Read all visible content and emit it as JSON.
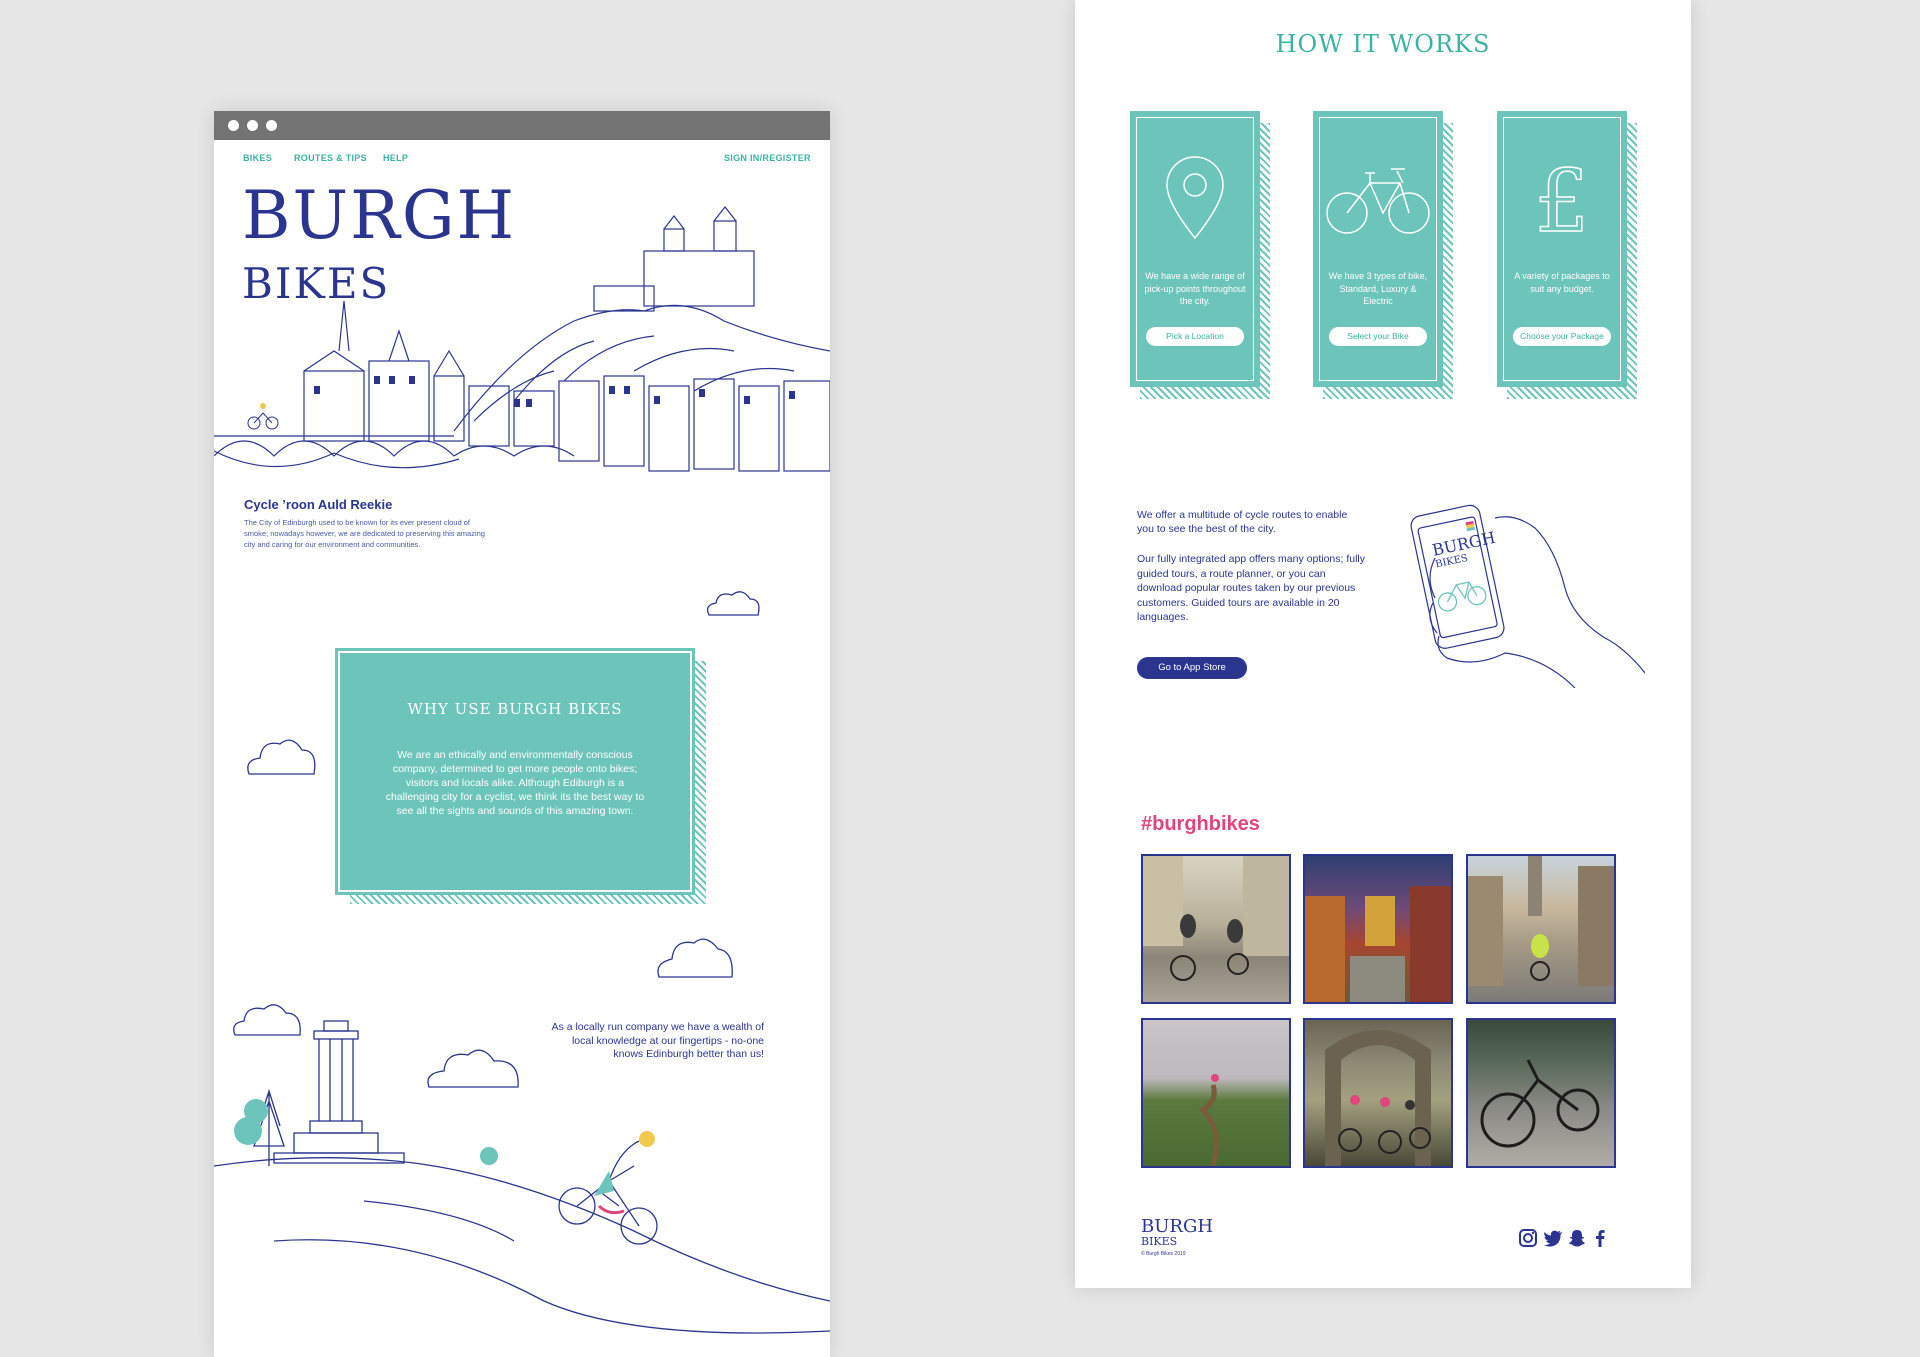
{
  "left_page": {
    "nav": {
      "bikes": "BIKES",
      "routes": "ROUTES & TIPS",
      "help": "HELP",
      "signin": "SIGN IN/REGISTER"
    },
    "logo": {
      "line1": "BURGH",
      "line2": "BIKES"
    },
    "intro": {
      "heading": "Cycle ’roon Auld Reekie",
      "body": "The City of Edinburgh used to be known for its ever present cloud of smoke; nowadays however, we are dedicated to preserving this amazing city and caring for our environment and communities."
    },
    "why": {
      "title": "WHY USE BURGH BIKES",
      "body": "We are an ethically and environmentally conscious company, determined to get more people onto bikes; visitors and locals alike. Although Ediburgh is a challenging city for a cyclist, we think its the best way to see all the sights and sounds of this amazing town."
    },
    "local_text": "As a locally run company we have a wealth of local knowledge at our fingertips - no-one knows Edinburgh better than us!"
  },
  "right_page": {
    "how_title": "HOW IT WORKS",
    "cards": [
      {
        "icon": "location-pin-icon",
        "text": "We have a wide range of pick-up points throughout the city.",
        "button": "Pick a Location"
      },
      {
        "icon": "bicycle-icon",
        "text": "We have 3 types of bike, Standard, Luxury & Electric",
        "button": "Select your Bike"
      },
      {
        "icon": "pound-icon",
        "text": "A variety of packages to suit any budget.",
        "button": "Choose your Package"
      }
    ],
    "routes": {
      "p1": "We offer a multitude of cycle routes to enable you to see the best of the city.",
      "p2": "Our fully integrated app offers many options; fully guided tours, a route planner, or you can download popular routes taken by our previous customers. Guided tours are available in 20 languages.",
      "app_button": "Go to App Store",
      "phone_logo1": "BURGH",
      "phone_logo2": "BIKES"
    },
    "hashtag": "#burghbikes",
    "footer": {
      "logo1": "BURGH",
      "logo2": "BIKES",
      "copyright": "© Burgh Bikes 2019"
    }
  },
  "colors": {
    "teal": "#6cc4ba",
    "navy": "#2b3590",
    "pink": "#e0457b",
    "background": "#e6e6e6"
  }
}
